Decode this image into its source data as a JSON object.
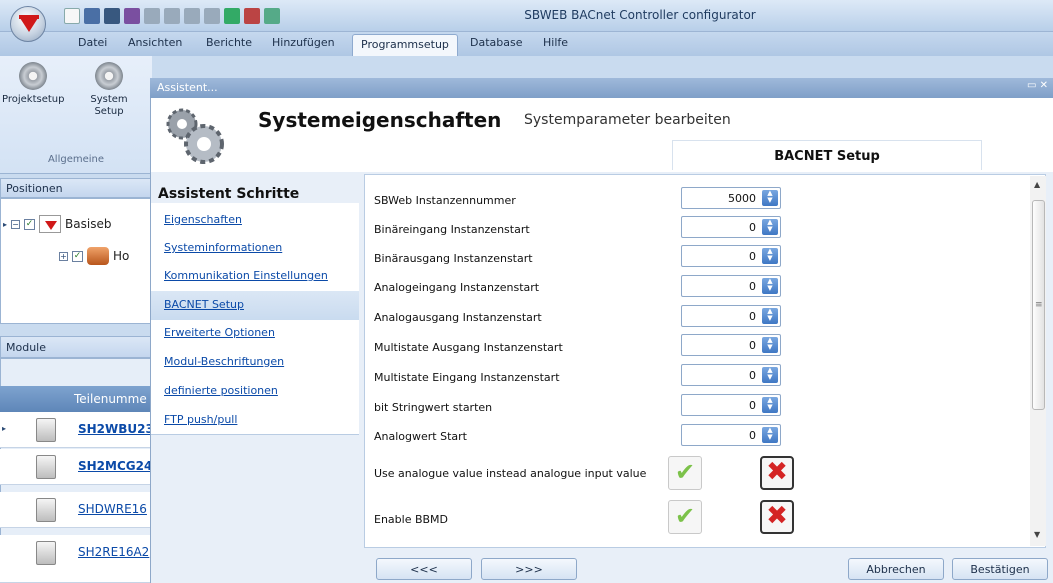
{
  "app": {
    "title": "SBWEB BACnet Controller configurator"
  },
  "menu": [
    "Datei",
    "Ansichten",
    "Berichte",
    "Hinzufügen",
    "Programmsetup",
    "Database",
    "Hilfe"
  ],
  "ribbon": {
    "buttons": [
      "Projektsetup",
      "System Setup"
    ],
    "group": "Allgemeine"
  },
  "positions": {
    "title": "Positionen",
    "nodes": [
      "Basiseb",
      "Ho"
    ]
  },
  "modules": {
    "title": "Module",
    "column": "Teilenumme",
    "rows": [
      {
        "part": "SH2WBU23",
        "bold": true
      },
      {
        "part": "SH2MCG24",
        "bold": true
      },
      {
        "part": "SHDWRE16",
        "bold": false
      },
      {
        "part": "SH2RE16A2",
        "bold": false
      }
    ]
  },
  "wizard": {
    "window_title": "Assistent...",
    "heading": "Systemeigenschaften",
    "subheading": "Systemparameter bearbeiten",
    "tab": "BACNET Setup",
    "steps_title": "Assistent Schritte",
    "steps": [
      "Eigenschaften",
      "Systeminformationen",
      "Kommunikation Einstellungen",
      "BACNET Setup",
      "Erweiterte Optionen",
      "Modul-Beschriftungen",
      "definierte positionen",
      "FTP push/pull"
    ],
    "selected_step": "BACNET Setup",
    "fields": [
      {
        "label": "SBWeb Instanzennummer",
        "value": "5000"
      },
      {
        "label": "Binäreingang Instanzenstart",
        "value": "0"
      },
      {
        "label": "Binärausgang Instanzenstart",
        "value": "0"
      },
      {
        "label": "Analogeingang Instanzenstart",
        "value": "0"
      },
      {
        "label": "Analogausgang Instanzenstart",
        "value": "0"
      },
      {
        "label": "Multistate Ausgang Instanzenstart",
        "value": "0"
      },
      {
        "label": "Multistate Eingang Instanzenstart",
        "value": "0"
      },
      {
        "label": "bit Stringwert starten",
        "value": "0"
      },
      {
        "label": "Analogwert Start",
        "value": "0"
      }
    ],
    "toggles": [
      {
        "label": "Use analogue value instead analogue input value"
      },
      {
        "label": "Enable BBMD"
      }
    ],
    "buttons": {
      "prev": "<<<",
      "next": ">>>",
      "cancel": "Abbrechen",
      "confirm": "Bestätigen"
    }
  },
  "colors": {
    "accent": "#d01818",
    "link": "#0b4aa8",
    "ok": "#7cc24a",
    "cancel_x": "#d42424"
  }
}
